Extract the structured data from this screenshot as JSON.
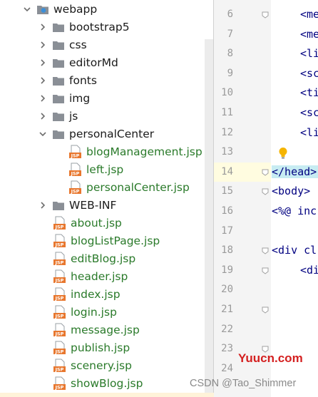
{
  "tree": {
    "items": [
      {
        "label": "webapp",
        "type": "web-folder",
        "depth": 0,
        "expanded": true
      },
      {
        "label": "bootstrap5",
        "type": "folder",
        "depth": 1,
        "expanded": false
      },
      {
        "label": "css",
        "type": "folder",
        "depth": 1,
        "expanded": false
      },
      {
        "label": "editorMd",
        "type": "folder",
        "depth": 1,
        "expanded": false
      },
      {
        "label": "fonts",
        "type": "folder",
        "depth": 1,
        "expanded": false
      },
      {
        "label": "img",
        "type": "folder",
        "depth": 1,
        "expanded": false
      },
      {
        "label": "js",
        "type": "folder",
        "depth": 1,
        "expanded": false
      },
      {
        "label": "personalCenter",
        "type": "folder",
        "depth": 1,
        "expanded": true
      },
      {
        "label": "blogManagement.jsp",
        "type": "jsp",
        "depth": 2
      },
      {
        "label": "left.jsp",
        "type": "jsp",
        "depth": 2
      },
      {
        "label": "personalCenter.jsp",
        "type": "jsp",
        "depth": 2
      },
      {
        "label": "WEB-INF",
        "type": "folder",
        "depth": 1,
        "expanded": false
      },
      {
        "label": "about.jsp",
        "type": "jsp",
        "depth": 1
      },
      {
        "label": "blogListPage.jsp",
        "type": "jsp",
        "depth": 1
      },
      {
        "label": "editBlog.jsp",
        "type": "jsp",
        "depth": 1
      },
      {
        "label": "header.jsp",
        "type": "jsp",
        "depth": 1
      },
      {
        "label": "index.jsp",
        "type": "jsp",
        "depth": 1
      },
      {
        "label": "login.jsp",
        "type": "jsp",
        "depth": 1
      },
      {
        "label": "message.jsp",
        "type": "jsp",
        "depth": 1
      },
      {
        "label": "publish.jsp",
        "type": "jsp",
        "depth": 1
      },
      {
        "label": "scenery.jsp",
        "type": "jsp",
        "depth": 1
      },
      {
        "label": "showBlog.jsp",
        "type": "jsp",
        "depth": 1
      }
    ],
    "jsp_badge": "JSP"
  },
  "editor": {
    "line_numbers": [
      "6",
      "7",
      "8",
      "9",
      "10",
      "11",
      "12",
      "13",
      "14",
      "15",
      "16",
      "17",
      "18",
      "19",
      "20",
      "21",
      "22",
      "23",
      "24"
    ],
    "lines": [
      {
        "n": "6",
        "text": "<me",
        "indent": 2
      },
      {
        "n": "7",
        "text": "<me",
        "indent": 2
      },
      {
        "n": "8",
        "text": "<li",
        "indent": 2
      },
      {
        "n": "9",
        "text": "<sc",
        "indent": 2
      },
      {
        "n": "10",
        "text": "<ti",
        "indent": 2
      },
      {
        "n": "11",
        "text": "<sc",
        "indent": 2
      },
      {
        "n": "12",
        "text": "<li",
        "indent": 2
      },
      {
        "n": "13",
        "text": "",
        "indent": 0
      },
      {
        "n": "14",
        "text": "</head>",
        "indent": 0
      },
      {
        "n": "15",
        "text": "<body>",
        "indent": 0
      },
      {
        "n": "16",
        "text": "<%@ inc",
        "indent": 0
      },
      {
        "n": "17",
        "text": "",
        "indent": 0
      },
      {
        "n": "18",
        "text": "<div cl",
        "indent": 0
      },
      {
        "n": "19",
        "text": "<di",
        "indent": 2
      },
      {
        "n": "20",
        "text": "",
        "indent": 0
      },
      {
        "n": "21",
        "text": "",
        "indent": 0
      },
      {
        "n": "22",
        "text": "",
        "indent": 0
      },
      {
        "n": "23",
        "text": "",
        "indent": 0
      },
      {
        "n": "24",
        "text": "",
        "indent": 0
      }
    ]
  },
  "watermarks": {
    "site": "Yuucn.com",
    "author": "CSDN @Tao_Shimmer"
  },
  "colors": {
    "folder": "#8a8f96",
    "jsp_text": "#2a7a2a",
    "jsp_badge": "#e8772e",
    "tag": "#000080",
    "watermark_red": "#d42020"
  }
}
